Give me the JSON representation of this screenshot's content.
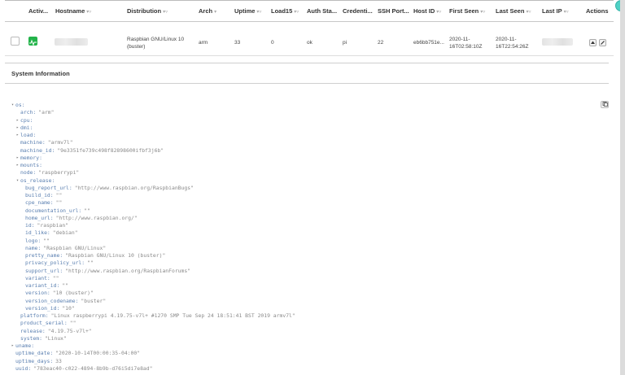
{
  "table": {
    "headers": [
      {
        "label": "Activ...",
        "sort": ""
      },
      {
        "label": "Hostname",
        "sort": "▾▿"
      },
      {
        "label": "Distribution",
        "sort": "▾▿"
      },
      {
        "label": "Arch",
        "sort": "▾"
      },
      {
        "label": "Uptime",
        "sort": "▾▿"
      },
      {
        "label": "Load15",
        "sort": "▾▿"
      },
      {
        "label": "Auth Sta...",
        "sort": ""
      },
      {
        "label": "Credenti...",
        "sort": ""
      },
      {
        "label": "SSH Port...",
        "sort": ""
      },
      {
        "label": "Host ID",
        "sort": "▾▿"
      },
      {
        "label": "First Seen",
        "sort": "▾▿"
      },
      {
        "label": "Last Seen",
        "sort": "▾▿"
      },
      {
        "label": "Last IP",
        "sort": "▾▿"
      },
      {
        "label": "Actions",
        "sort": ""
      }
    ],
    "row": {
      "distribution_line1": "Raspbian GNU/Linux 10",
      "distribution_line2": "(buster)",
      "arch": "arm",
      "uptime": "33",
      "load15": "0",
      "auth_status": "ok",
      "credentials": "pi",
      "ssh_port": "22",
      "host_id": "eb6bb751e...",
      "first_seen_line1": "2020-11-",
      "first_seen_line2": "16T02:58:10Z",
      "last_seen_line1": "2020-11-",
      "last_seen_line2": "16T22:54:26Z"
    }
  },
  "section_title": "System Information",
  "tree": [
    {
      "text": "os:",
      "depth": 0,
      "toggle": "▾",
      "value": ""
    },
    {
      "text": "arch:",
      "depth": 1,
      "toggle": "",
      "value": "\"arm\""
    },
    {
      "text": "cpu:",
      "depth": 1,
      "toggle": "▸",
      "value": ""
    },
    {
      "text": "dmi:",
      "depth": 1,
      "toggle": "▸",
      "value": ""
    },
    {
      "text": "load:",
      "depth": 1,
      "toggle": "▸",
      "value": ""
    },
    {
      "text": "machine:",
      "depth": 1,
      "toggle": "",
      "value": "\"armv7l\""
    },
    {
      "text": "machine_id:",
      "depth": 1,
      "toggle": "",
      "value": "\"9e3351fe739c498f82898600ifbf3j6b\""
    },
    {
      "text": "memory:",
      "depth": 1,
      "toggle": "▸",
      "value": ""
    },
    {
      "text": "mounts:",
      "depth": 1,
      "toggle": "▸",
      "value": ""
    },
    {
      "text": "node:",
      "depth": 1,
      "toggle": "",
      "value": "\"raspberrypi\""
    },
    {
      "text": "os_release:",
      "depth": 1,
      "toggle": "▾",
      "value": ""
    },
    {
      "text": "bug_report_url:",
      "depth": 2,
      "toggle": "",
      "value": "\"http://www.raspbian.org/RaspbianBugs\""
    },
    {
      "text": "build_id:",
      "depth": 2,
      "toggle": "",
      "value": "\"\""
    },
    {
      "text": "cpe_name:",
      "depth": 2,
      "toggle": "",
      "value": "\"\""
    },
    {
      "text": "documentation_url:",
      "depth": 2,
      "toggle": "",
      "value": "\"\""
    },
    {
      "text": "home_url:",
      "depth": 2,
      "toggle": "",
      "value": "\"http://www.raspbian.org/\""
    },
    {
      "text": "id:",
      "depth": 2,
      "toggle": "",
      "value": "\"raspbian\""
    },
    {
      "text": "id_like:",
      "depth": 2,
      "toggle": "",
      "value": "\"debian\""
    },
    {
      "text": "logo:",
      "depth": 2,
      "toggle": "",
      "value": "\"\""
    },
    {
      "text": "name:",
      "depth": 2,
      "toggle": "",
      "value": "\"Raspbian GNU/Linux\""
    },
    {
      "text": "pretty_name:",
      "depth": 2,
      "toggle": "",
      "value": "\"Raspbian GNU/Linux 10 (buster)\""
    },
    {
      "text": "privacy_policy_url:",
      "depth": 2,
      "toggle": "",
      "value": "\"\""
    },
    {
      "text": "support_url:",
      "depth": 2,
      "toggle": "",
      "value": "\"http://www.raspbian.org/RaspbianForums\""
    },
    {
      "text": "variant:",
      "depth": 2,
      "toggle": "",
      "value": "\"\""
    },
    {
      "text": "variant_id:",
      "depth": 2,
      "toggle": "",
      "value": "\"\""
    },
    {
      "text": "version:",
      "depth": 2,
      "toggle": "",
      "value": "\"10 (buster)\""
    },
    {
      "text": "version_codename:",
      "depth": 2,
      "toggle": "",
      "value": "\"buster\""
    },
    {
      "text": "version_id:",
      "depth": 2,
      "toggle": "",
      "value": "\"10\""
    },
    {
      "text": "platform:",
      "depth": 1,
      "toggle": "",
      "value": "\"Linux raspberrypi 4.19.75-v7l+ #1270 SMP Tue Sep 24 18:51:41 BST 2019 armv7l\""
    },
    {
      "text": "product_serial:",
      "depth": 1,
      "toggle": "",
      "value": "\"\""
    },
    {
      "text": "release:",
      "depth": 1,
      "toggle": "",
      "value": "\"4.19.75-v7l+\""
    },
    {
      "text": "system:",
      "depth": 1,
      "toggle": "",
      "value": "\"Linux\""
    },
    {
      "text": "uname:",
      "depth": 0,
      "toggle": "▸",
      "value": ""
    },
    {
      "text": "uptime_date:",
      "depth": 0,
      "toggle": "",
      "value": "\"2020-10-14T00:00:35-04:00\""
    },
    {
      "text": "uptime_days:",
      "depth": 0,
      "toggle": "",
      "value": "33"
    },
    {
      "text": "uuid:",
      "depth": 0,
      "toggle": "",
      "value": "\"783eac40-c022-4894-8b9b-d76i5di7e8ad\""
    }
  ],
  "colors": {
    "activity": "#23b34a",
    "key": "#5a7fb0",
    "value": "#8a8a8a"
  },
  "icons": {
    "activity": "pulse-icon",
    "terminal": "terminal-icon",
    "edit": "pencil-icon",
    "copy": "copy-icon"
  }
}
